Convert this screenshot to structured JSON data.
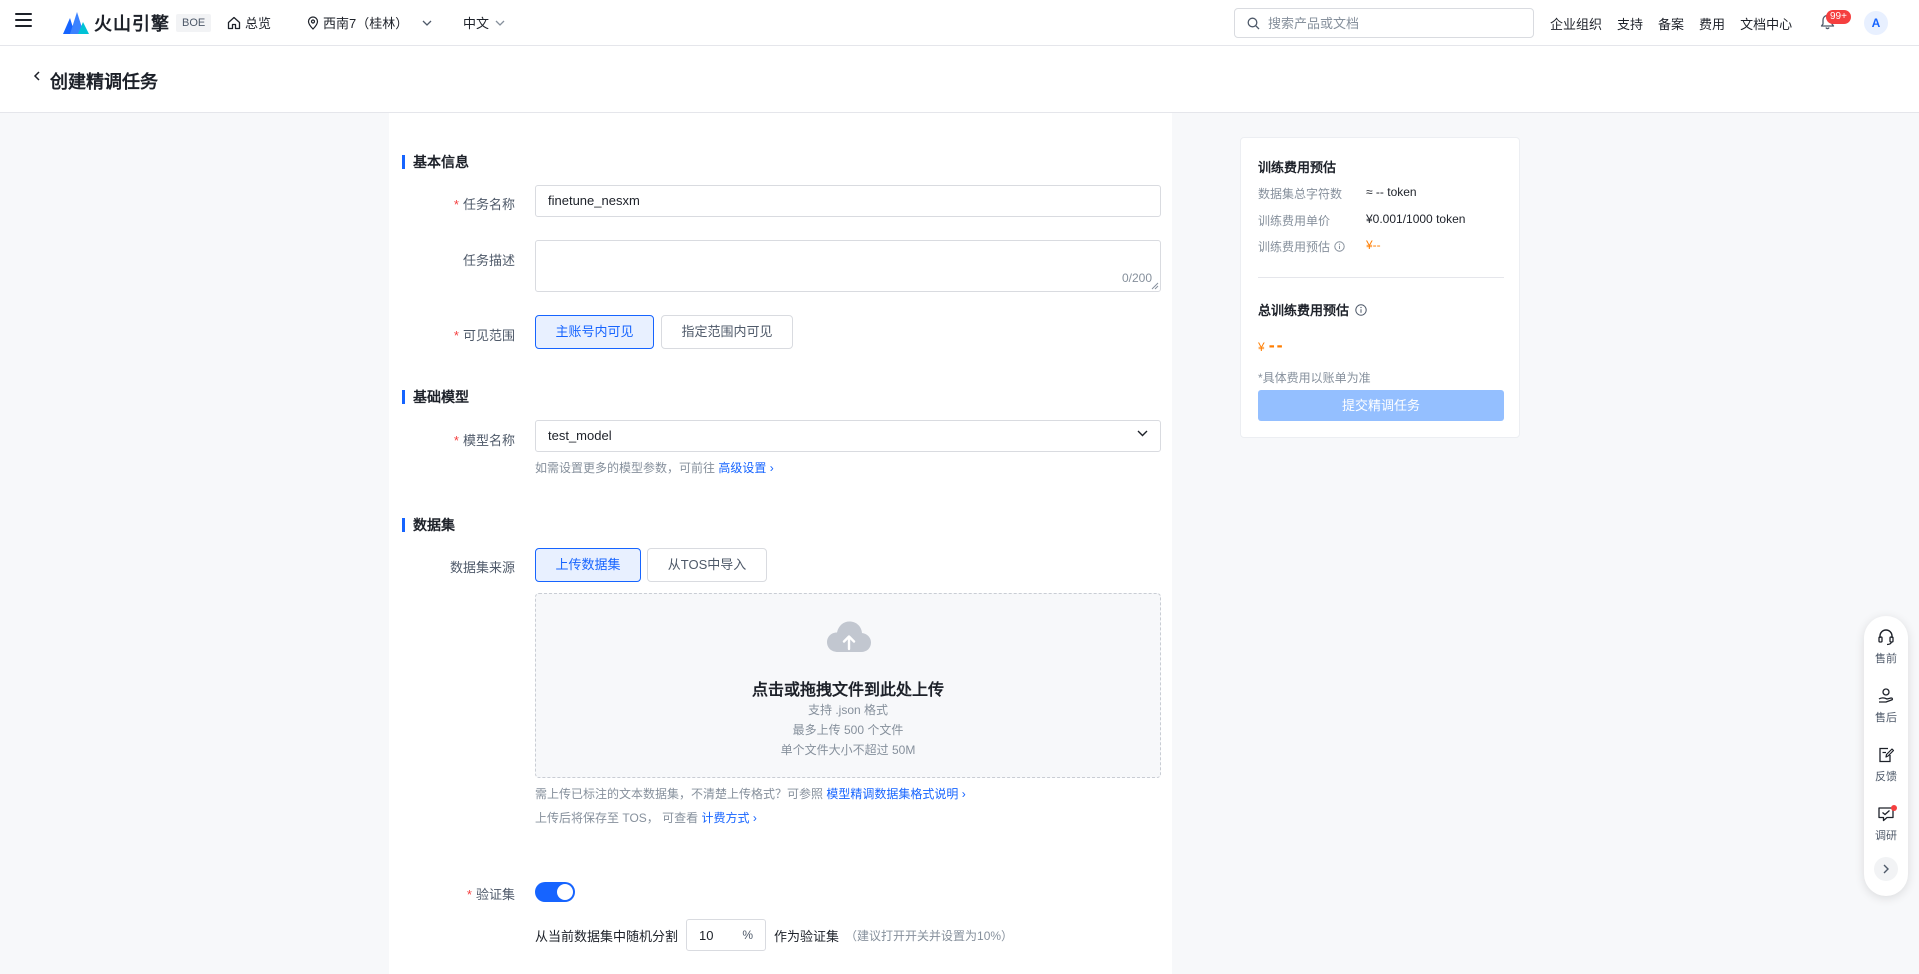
{
  "topbar": {
    "brand": "火山引擎",
    "env_badge": "BOE",
    "overview": "总览",
    "region": "西南7（桂林）",
    "language": "中文",
    "search_placeholder": "搜索产品或文档",
    "links": [
      "企业组织",
      "支持",
      "备案",
      "费用",
      "文档中心"
    ],
    "notification_count": "99+",
    "avatar_initial": "A"
  },
  "page": {
    "title": "创建精调任务"
  },
  "basic_info": {
    "section_title": "基本信息",
    "task_name_label": "任务名称",
    "task_name_value": "finetune_nesxm",
    "task_desc_label": "任务描述",
    "task_desc_count": "0/200",
    "visibility_label": "可见范围",
    "visibility_options": [
      "主账号内可见",
      "指定范围内可见"
    ]
  },
  "base_model": {
    "section_title": "基础模型",
    "model_label": "模型名称",
    "model_value": "test_model",
    "help_prefix": "如需设置更多的模型参数，可前往",
    "help_link": "高级设置"
  },
  "dataset": {
    "section_title": "数据集",
    "source_label": "数据集来源",
    "source_options": [
      "上传数据集",
      "从TOS中导入"
    ],
    "upload_title": "点击或拖拽文件到此处上传",
    "upload_lines": [
      "支持 .json 格式",
      "最多上传 500 个文件",
      "单个文件大小不超过 50M"
    ],
    "help1_prefix": "需上传已标注的文本数据集，不清楚上传格式？可参照",
    "help1_link": "模型精调数据集格式说明",
    "help2_prefix": "上传后将保存至 TOS，  可查看",
    "help2_link": "计费方式"
  },
  "validation": {
    "label": "验证集",
    "enabled": true,
    "split_prefix": "从当前数据集中随机分割",
    "split_value": "10",
    "split_unit": "%",
    "split_suffix": "作为验证集",
    "split_note": "（建议打开开关并设置为10%）"
  },
  "cost": {
    "title": "训练费用预估",
    "rows": [
      {
        "label": "数据集总字符数",
        "value": "≈ -- token"
      },
      {
        "label": "训练费用单价",
        "value": "¥0.001/1000 token"
      },
      {
        "label": "训练费用预估",
        "value": "¥--"
      }
    ],
    "total_title": "总训练费用预估",
    "total_currency": "¥",
    "total_value": "--",
    "note": "*具体费用以账单为准",
    "submit": "提交精调任务"
  },
  "float_bar": {
    "items": [
      "售前",
      "售后",
      "反馈",
      "调研"
    ]
  },
  "colors": {
    "primary": "#1664ff",
    "warning": "#ff7d00",
    "danger": "#f53f3f",
    "disabled_button": "#94bfff"
  }
}
